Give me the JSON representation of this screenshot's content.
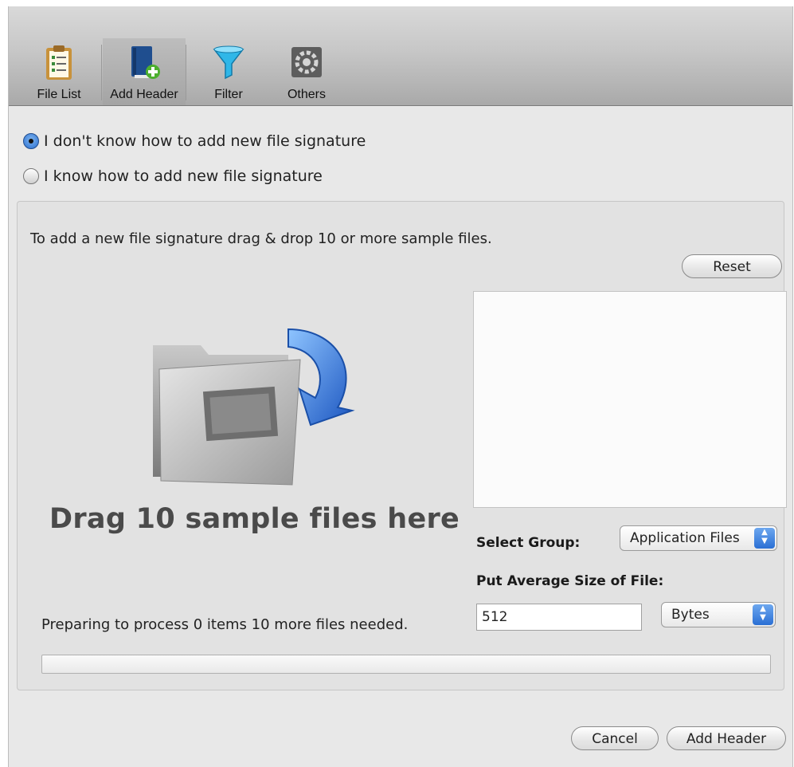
{
  "toolbar": {
    "items": [
      {
        "label": "File List",
        "icon": "clipboard-list-icon"
      },
      {
        "label": "Add Header",
        "icon": "book-add-icon"
      },
      {
        "label": "Filter",
        "icon": "funnel-icon"
      },
      {
        "label": "Others",
        "icon": "gear-icon"
      }
    ],
    "active_index": 1
  },
  "mode": {
    "option_unknown": "I don't know how to add new file signature",
    "option_known": "I know how to add new file signature",
    "selected": "unknown"
  },
  "panel": {
    "instruction": "To add a new file signature drag & drop 10 or more sample files.",
    "reset_label": "Reset",
    "drop_text": "Drag 10 sample files here",
    "select_group_label": "Select Group:",
    "select_group_value": "Application Files",
    "avg_size_label": "Put Average Size of File:",
    "avg_size_value": "512",
    "unit_value": "Bytes",
    "status": "Preparing to process 0 items 10 more files needed.",
    "progress": 0
  },
  "footer": {
    "cancel_label": "Cancel",
    "add_header_label": "Add Header"
  },
  "colors": {
    "accent": "#2a6fd4",
    "window_bg": "#e8e8e8"
  }
}
